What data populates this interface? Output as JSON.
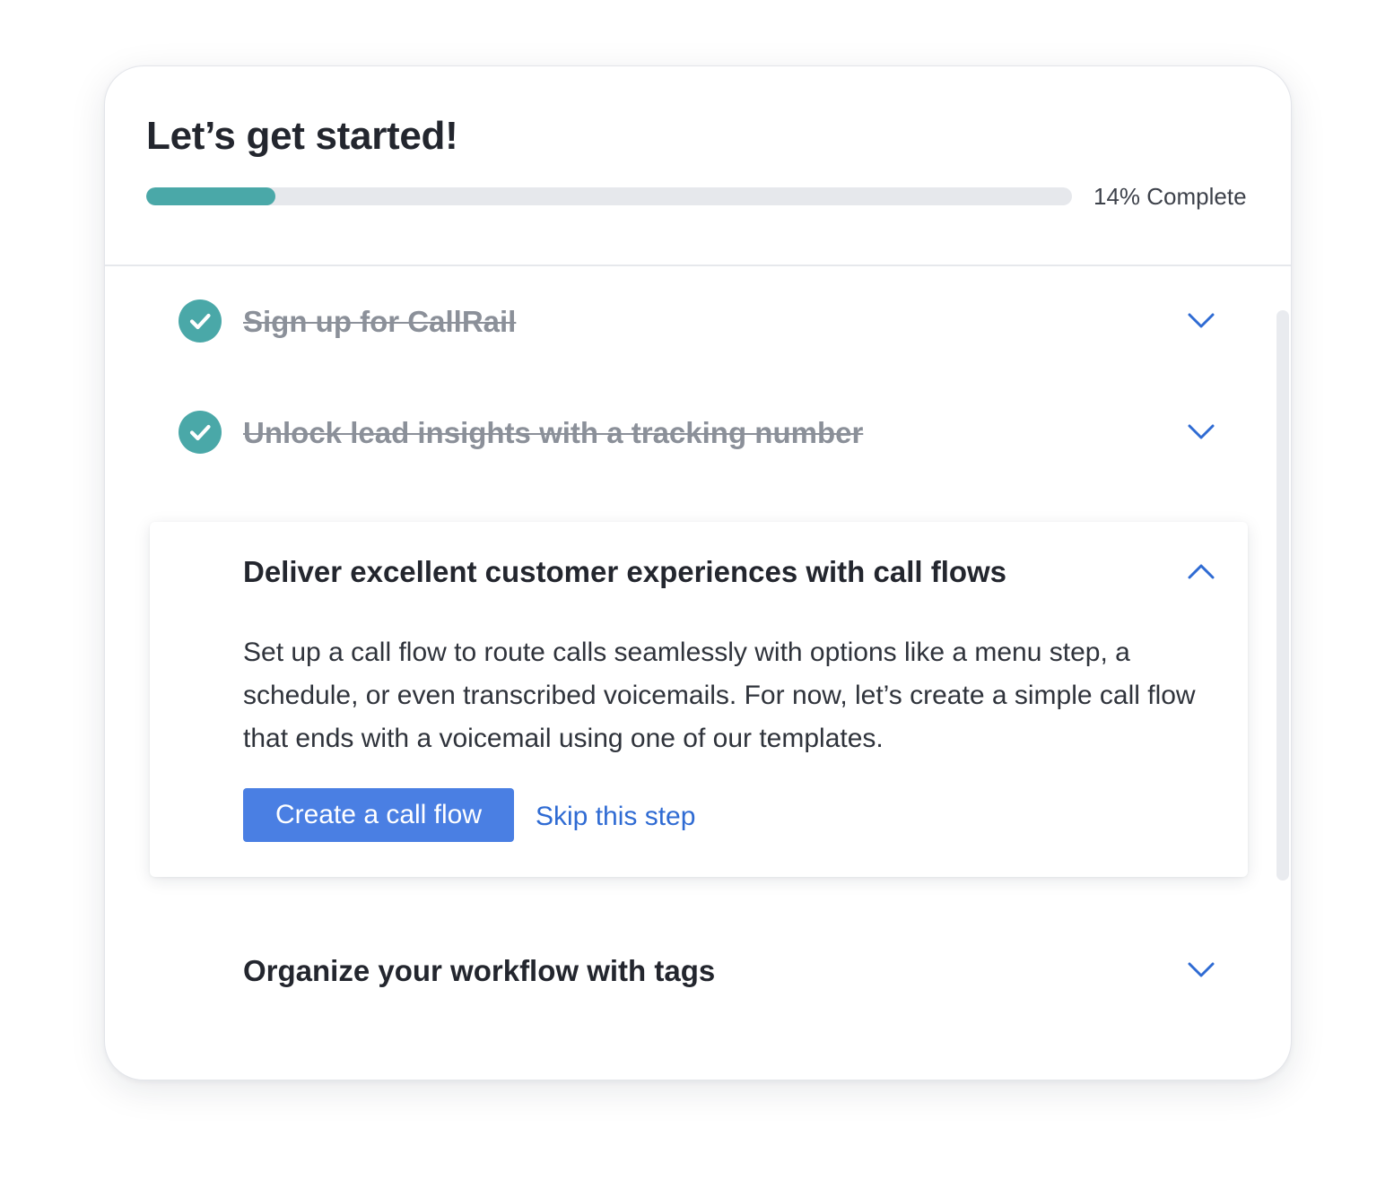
{
  "header": {
    "title": "Let’s get started!",
    "progress_percent": 14,
    "progress_label": "14% Complete"
  },
  "colors": {
    "accent_teal": "#4aa8a8",
    "primary_blue": "#4a7fe3",
    "link_blue": "#2f6bd3",
    "chevron_blue": "#2f6bd3"
  },
  "steps": [
    {
      "label": "Sign up for CallRail",
      "status": "completed",
      "icon": "check-circle-icon",
      "chevron": "chevron-down-icon"
    },
    {
      "label": "Unlock lead insights with a tracking number",
      "status": "completed",
      "icon": "check-circle-icon",
      "chevron": "chevron-down-icon"
    },
    {
      "label": "Deliver excellent customer experiences with call flows",
      "status": "expanded",
      "chevron": "chevron-up-icon",
      "description": "Set up a call flow to route calls seamlessly with options like a menu step, a schedule, or even transcribed voicemails. For now, let’s create a simple call flow that ends with a voicemail using one of our templates.",
      "primary_action": "Create a call flow",
      "secondary_action": "Skip this step"
    },
    {
      "label": "Organize your workflow with tags",
      "status": "pending",
      "chevron": "chevron-down-icon"
    }
  ]
}
